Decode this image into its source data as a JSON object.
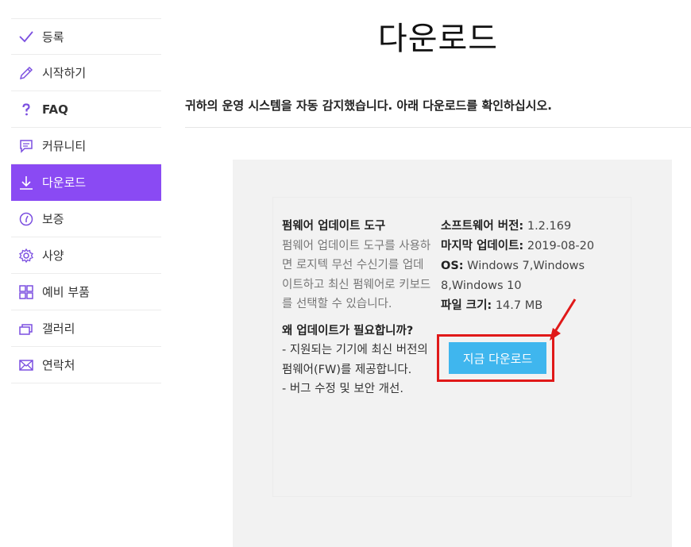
{
  "sidebar": {
    "items": [
      {
        "label": "등록",
        "icon": "check-icon"
      },
      {
        "label": "시작하기",
        "icon": "pencil-icon"
      },
      {
        "label": "FAQ",
        "icon": "question-icon"
      },
      {
        "label": "커뮤니티",
        "icon": "chat-icon"
      },
      {
        "label": "다운로드",
        "icon": "download-icon",
        "active": true
      },
      {
        "label": "보증",
        "icon": "clock-icon"
      },
      {
        "label": "사양",
        "icon": "gear-icon"
      },
      {
        "label": "예비 부품",
        "icon": "grid-icon"
      },
      {
        "label": "갤러리",
        "icon": "gallery-icon"
      },
      {
        "label": "연락처",
        "icon": "mail-icon"
      }
    ]
  },
  "main": {
    "title": "다운로드",
    "subtitle": "귀하의 운영 시스템을 자동 감지했습니다. 아래 다운로드를 확인하십시오.",
    "product": {
      "name": "펌웨어 업데이트 도구",
      "description": "펌웨어 업데이트 도구를 사용하면 로지텍 무선 수신기를 업데이트하고 최신 펌웨어로 키보드를 선택할 수 있습니다.",
      "why_heading": "왜 업데이트가 필요합니까?",
      "why_line1": "- 지원되는 기기에 최신 버전의 펌웨어(FW)를 제공합니다.",
      "why_line2": "- 버그 수정 및 보안 개선."
    },
    "details": {
      "version_label": "소프트웨어 버전:",
      "version_value": " 1.2.169",
      "updated_label": "마지막 업데이트:",
      "updated_value": " 2019-08-20",
      "os_label": "OS:",
      "os_value": " Windows 7,Windows 8,Windows 10",
      "size_label": "파일 크기:",
      "size_value": " 14.7 MB"
    },
    "download_button": "지금 다운로드"
  },
  "colors": {
    "accent": "#8a4af3",
    "button": "#3fb6ee",
    "highlight": "#e01919"
  }
}
